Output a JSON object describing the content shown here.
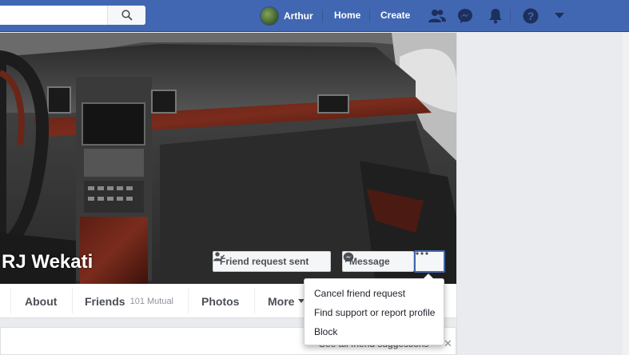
{
  "topbar": {
    "search_placeholder": "",
    "user_name": "Arthur",
    "home_label": "Home",
    "create_label": "Create"
  },
  "profile": {
    "name": "RJ Wekati",
    "friend_request_label": "Friend request sent",
    "message_label": "Message"
  },
  "tabs": [
    {
      "label": "About"
    },
    {
      "label": "Friends",
      "count": "101 Mutual"
    },
    {
      "label": "Photos"
    },
    {
      "label": "More"
    }
  ],
  "dropdown": {
    "items": [
      {
        "label": "Cancel friend request"
      },
      {
        "label": "Find support or report profile"
      },
      {
        "label": "Block"
      }
    ]
  },
  "suggestions": {
    "link_label": "See all friend suggestions"
  },
  "colors": {
    "brand": "#4267b2",
    "text_secondary": "#4b4f56"
  }
}
